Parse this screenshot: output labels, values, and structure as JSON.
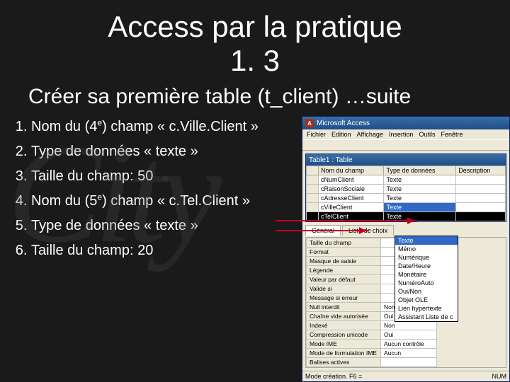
{
  "title_line1": "Access par la pratique",
  "title_line2": "1. 3",
  "subtitle": "Créer sa première table (t_client) …suite",
  "steps": [
    "Nom du (4e) champ « c.Ville.Client »",
    "Type de données « texte »",
    "Taille du champ: 50",
    "Nom du (5e) champ « c.Tel.Client »",
    "Type de données « texte »",
    "Taille du champ: 20"
  ],
  "shot": {
    "app_title": "Microsoft Access",
    "menus": [
      "Fichier",
      "Edition",
      "Affichage",
      "Insertion",
      "Outils",
      "Fenêtre"
    ],
    "table_title": "Table1 : Table",
    "columns": [
      "Nom du champ",
      "Type de données",
      "Description"
    ],
    "rows": [
      {
        "name": "cNumClient",
        "type": "Texte"
      },
      {
        "name": "cRaisonSociale",
        "type": "Texte"
      },
      {
        "name": "cAdresseClient",
        "type": "Texte"
      },
      {
        "name": "cVilleClient",
        "type": "Texte",
        "selType": true
      },
      {
        "name": "cTelClient",
        "type": "Texte",
        "selRow": true
      }
    ],
    "dropdown": [
      "Texte",
      "Mémo",
      "Numérique",
      "Date/Heure",
      "Monétaire",
      "NuméroAuto",
      "Oui/Non",
      "Objet OLE",
      "Lien hypertexte",
      "Assistant Liste de c"
    ],
    "dropdown_selected": "Texte",
    "tabs": [
      "Général",
      "Liste de choix"
    ],
    "props_left": [
      "Taille du champ",
      "Format",
      "Masque de saisie",
      "Légende",
      "Valeur par défaut",
      "Valide si",
      "Message si erreur",
      "Null interdit",
      "Chaîne vide autorisée",
      "Indexé",
      "Compression unicode",
      "Mode IME",
      "Mode de formulation IME",
      "Balises actives"
    ],
    "props_right": [
      {
        "k": "Null interdit",
        "v": "Non"
      },
      {
        "k": "Chaîne vide autorisée",
        "v": "Oui"
      },
      {
        "k": "Indexé",
        "v": "Non"
      },
      {
        "k": "Compression unicode",
        "v": "Oui"
      },
      {
        "k": "Mode IME",
        "v": "Aucun contrôle"
      },
      {
        "k": "Mode de formulation IME",
        "v": "Aucun"
      }
    ],
    "status_left": "Mode création. F6 = ",
    "status_right": "NUM"
  },
  "ghost": "City"
}
